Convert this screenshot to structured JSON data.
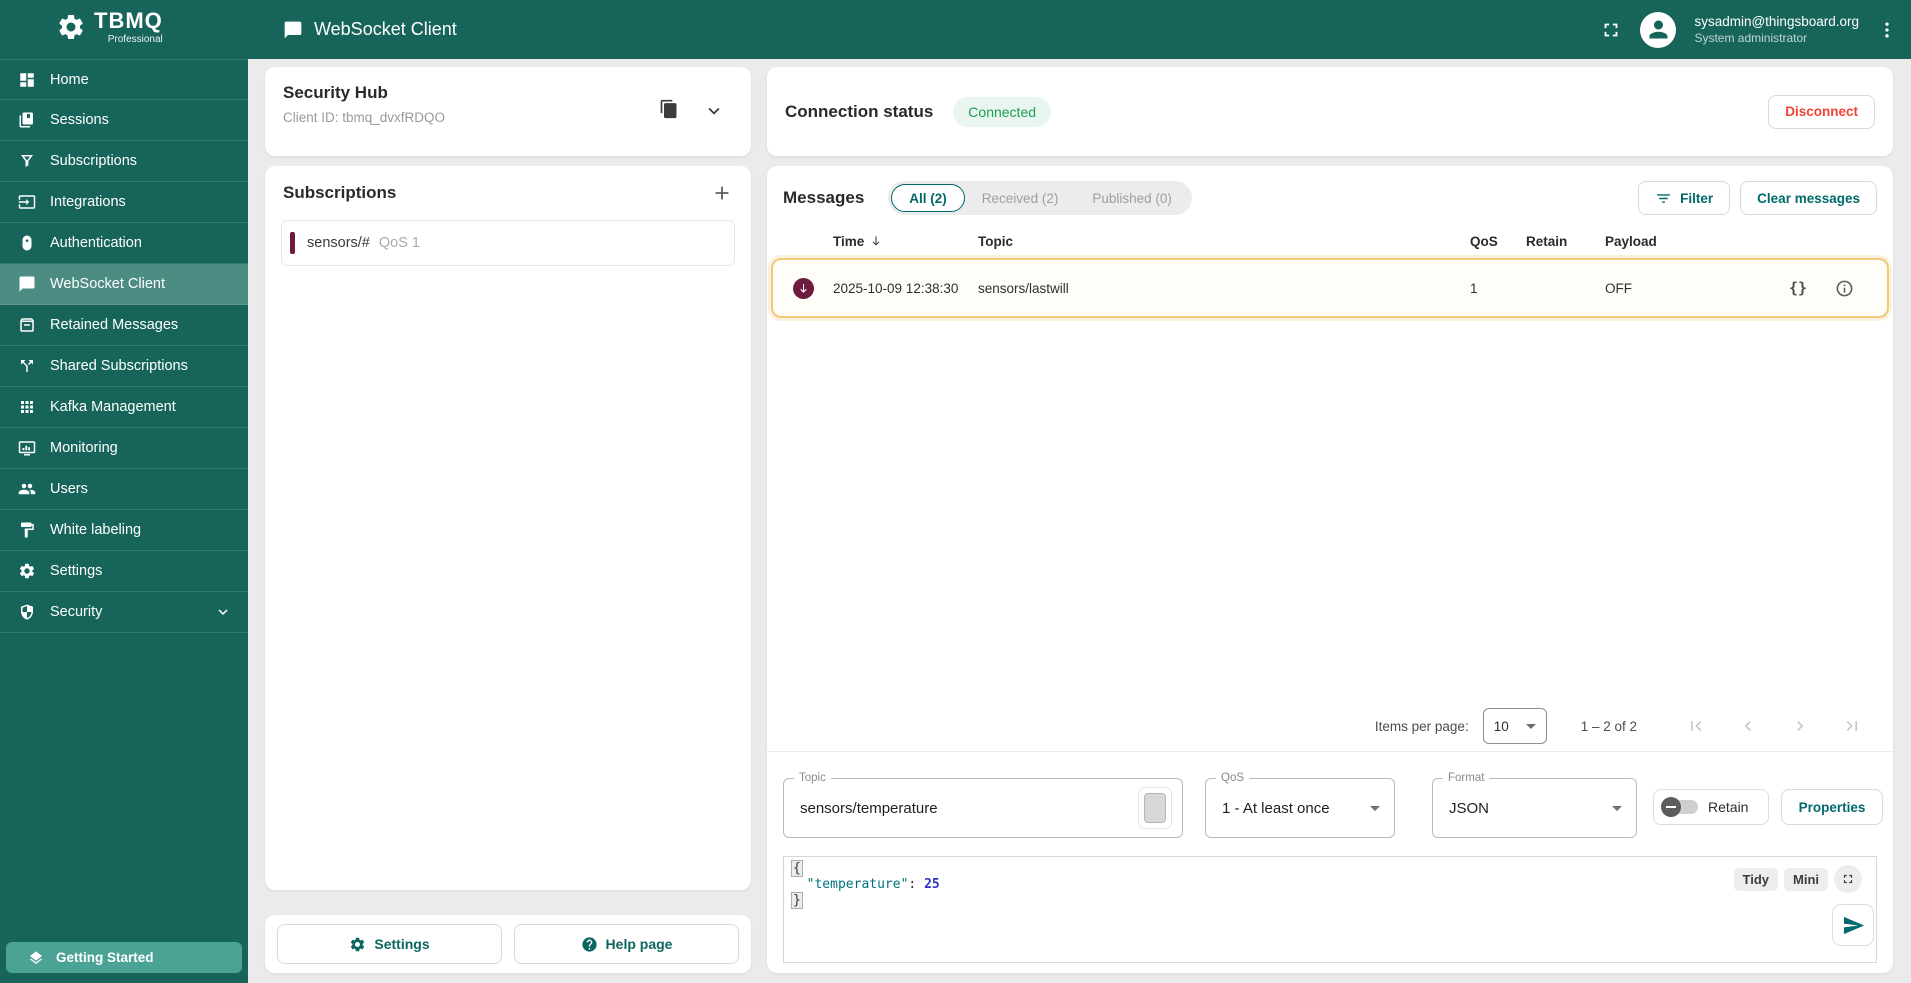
{
  "header": {
    "logo_title": "TBMQ",
    "logo_subtitle": "Professional",
    "page_title": "WebSocket Client",
    "user_email": "sysadmin@thingsboard.org",
    "user_role": "System administrator"
  },
  "sidebar": {
    "items": [
      {
        "label": "Home",
        "icon": "dashboard-icon",
        "selected": false
      },
      {
        "label": "Sessions",
        "icon": "sessions-book-icon",
        "selected": false
      },
      {
        "label": "Subscriptions",
        "icon": "funnel-icon",
        "selected": false
      },
      {
        "label": "Integrations",
        "icon": "input-icon",
        "selected": false
      },
      {
        "label": "Authentication",
        "icon": "lock-icon",
        "selected": false
      },
      {
        "label": "WebSocket Client",
        "icon": "chat-icon",
        "selected": true
      },
      {
        "label": "Retained Messages",
        "icon": "archive-icon",
        "selected": false
      },
      {
        "label": "Shared Subscriptions",
        "icon": "call-split-icon",
        "selected": false
      },
      {
        "label": "Kafka Management",
        "icon": "apps-grid-icon",
        "selected": false
      },
      {
        "label": "Monitoring",
        "icon": "monitor-icon",
        "selected": false
      },
      {
        "label": "Users",
        "icon": "people-icon",
        "selected": false
      },
      {
        "label": "White labeling",
        "icon": "paint-icon",
        "selected": false
      },
      {
        "label": "Settings",
        "icon": "gear-icon",
        "selected": false
      },
      {
        "label": "Security",
        "icon": "shield-icon",
        "selected": false,
        "expandable": true
      }
    ],
    "getting_started_label": "Getting Started"
  },
  "security_hub": {
    "title": "Security Hub",
    "client_id": "Client ID: tbmq_dvxfRDQO"
  },
  "subscriptions_panel": {
    "title": "Subscriptions",
    "items": [
      {
        "topic": "sensors/#",
        "qos": "QoS 1"
      }
    ]
  },
  "connection": {
    "title": "Connection status",
    "status_badge": "Connected",
    "disconnect_label": "Disconnect"
  },
  "messages": {
    "title": "Messages",
    "tabs": [
      {
        "label": "All (2)",
        "selected": true
      },
      {
        "label": "Received (2)",
        "selected": false
      },
      {
        "label": "Published (0)",
        "selected": false
      }
    ],
    "filter_label": "Filter",
    "clear_label": "Clear messages",
    "columns": {
      "time": "Time",
      "topic": "Topic",
      "qos": "QoS",
      "retain": "Retain",
      "payload": "Payload"
    },
    "rows": [
      {
        "direction": "received",
        "time": "2025-10-09 12:38:30",
        "topic": "sensors/lastwill",
        "qos": "1",
        "retain": "",
        "payload": "OFF",
        "payload_action": "{}"
      }
    ]
  },
  "pagination": {
    "items_per_page_label": "Items per page:",
    "items_per_page_value": "10",
    "range_label": "1 – 2 of 2"
  },
  "publish": {
    "topic_label": "Topic",
    "topic_value": "sensors/temperature",
    "qos_label": "QoS",
    "qos_value": "1 - At least once",
    "format_label": "Format",
    "format_value": "JSON",
    "retain_label": "Retain",
    "properties_label": "Properties"
  },
  "editor": {
    "open_brace": "{",
    "key": "\"temperature\"",
    "separator": ": ",
    "value": "25",
    "close_brace": "}",
    "tidy_label": "Tidy",
    "mini_label": "Mini"
  },
  "footer": {
    "settings_label": "Settings",
    "help_label": "Help page"
  },
  "colors": {
    "sidebar": "#17655a",
    "sidebar_selected": "#4d8c82",
    "accent_teal": "#00696c",
    "connected_green": "#1d9e54",
    "disconnect_red": "#f44336",
    "highlight_amber": "#f2c879",
    "subscription_maroon": "#6d1b3f",
    "getting_started_teal": "#4aa394"
  }
}
